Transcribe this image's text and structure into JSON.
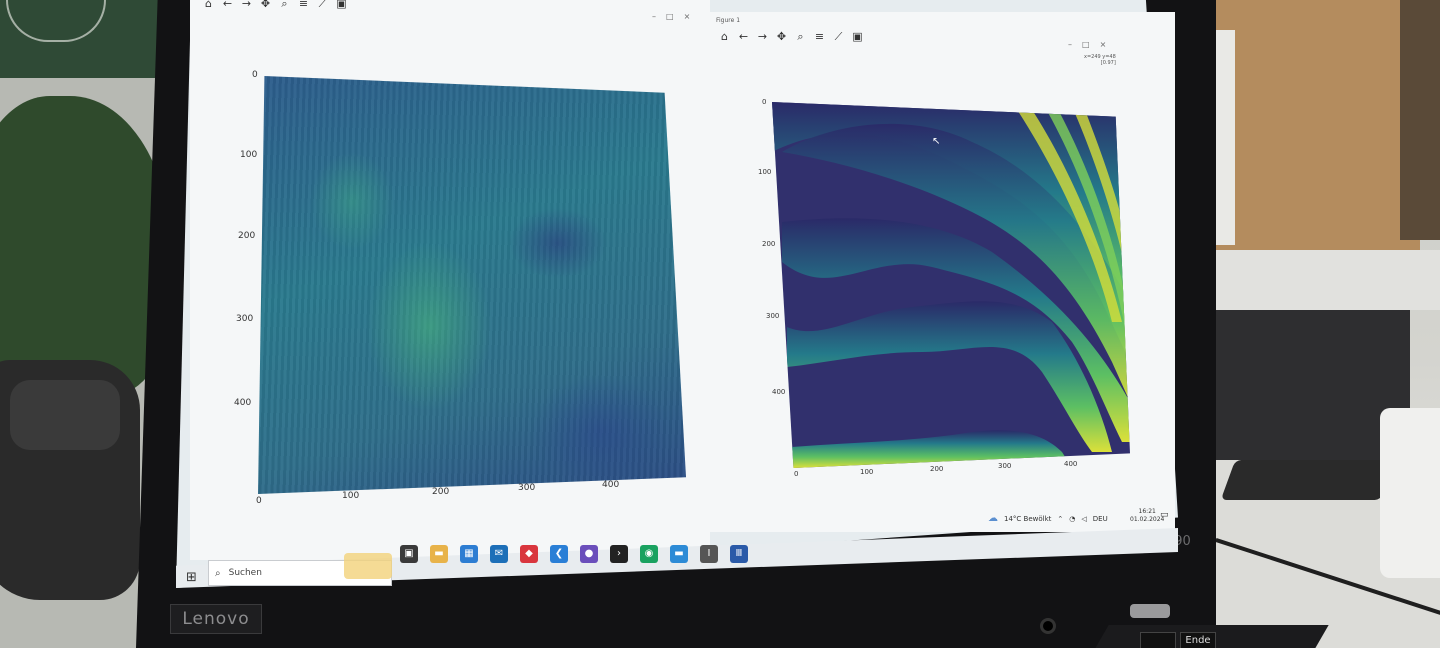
{
  "scene": {
    "laptop_brand": "Lenovo",
    "laptop_model": "T490"
  },
  "left_window": {
    "toolbar_icons": [
      "home-icon",
      "back-arrow-icon",
      "forward-arrow-icon",
      "pan-icon",
      "zoom-icon",
      "configure-subplots-icon",
      "edit-axes-icon",
      "save-icon"
    ],
    "controls": [
      "–",
      "□",
      "×"
    ],
    "y_ticks": [
      "0",
      "100",
      "200",
      "300",
      "400"
    ],
    "x_ticks": [
      "0",
      "100",
      "200",
      "300",
      "400"
    ]
  },
  "right_window": {
    "title": "Figure 1",
    "toolbar_icons": [
      "home-icon",
      "back-arrow-icon",
      "forward-arrow-icon",
      "pan-icon",
      "zoom-icon",
      "configure-subplots-icon",
      "edit-axes-icon",
      "save-icon"
    ],
    "controls": [
      "–",
      "□",
      "×"
    ],
    "coord_readout": "x=249 y=48\n[0.97]",
    "y_ticks": [
      "0",
      "100",
      "200",
      "300",
      "400"
    ],
    "x_ticks": [
      "0",
      "100",
      "200",
      "300",
      "400"
    ]
  },
  "taskbar": {
    "search_label": "Suchen",
    "apps": [
      {
        "name": "task-view-icon",
        "color": "#3a3a3a",
        "glyph": "▣"
      },
      {
        "name": "file-explorer-icon",
        "color": "#e8b34a",
        "glyph": "▬"
      },
      {
        "name": "store-icon",
        "color": "#2d7dd2",
        "glyph": "▦"
      },
      {
        "name": "mail-icon",
        "color": "#1d6fb8",
        "glyph": "✉"
      },
      {
        "name": "app-red-icon",
        "color": "#d9363e",
        "glyph": "◆"
      },
      {
        "name": "vscode-icon",
        "color": "#2a7fd6",
        "glyph": "❮"
      },
      {
        "name": "github-icon",
        "color": "#6b4fbb",
        "glyph": "●"
      },
      {
        "name": "terminal-icon",
        "color": "#222222",
        "glyph": "›"
      },
      {
        "name": "chrome-icon",
        "color": "#1aa260",
        "glyph": "◉"
      },
      {
        "name": "folder-icon",
        "color": "#2d8bd6",
        "glyph": "▬"
      },
      {
        "name": "python-window-icon",
        "color": "#555555",
        "glyph": "I"
      },
      {
        "name": "figure-window-icon",
        "color": "#2a5aa8",
        "glyph": "Ⅲ"
      }
    ],
    "weather": "14°C Bewölkt",
    "language": "DEU",
    "time": "16:21",
    "date": "01.02.2024"
  }
}
